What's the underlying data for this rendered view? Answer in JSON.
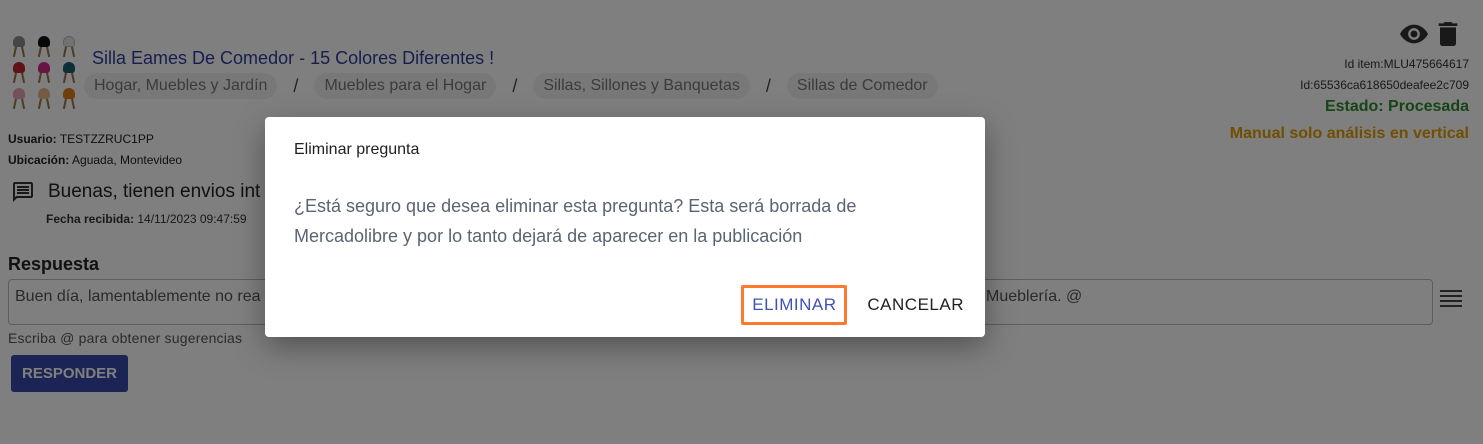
{
  "item": {
    "title": "Silla Eames De Comedor - 15 Colores Diferentes !",
    "breadcrumbs": [
      "Hogar, Muebles y Jardín",
      "Muebles para el Hogar",
      "Sillas, Sillones y Banquetas",
      "Sillas de Comedor"
    ],
    "breadcrumb_separator": "/",
    "thumbnail_icon": "chair-grid-thumbnail",
    "chair_colors": [
      "#8a8a8a",
      "#111111",
      "#e6e6e6",
      "#c0272d",
      "#d12a8c",
      "#1b5e6a",
      "#e8a0b4",
      "#e8b68f",
      "#e07a1a"
    ]
  },
  "user": {
    "usuario_label": "Usuario:",
    "usuario_value": "TESTZZRUC1PP",
    "ubicacion_label": "Ubicación:",
    "ubicacion_value": "Aguada, Montevideo"
  },
  "question": {
    "icon": "chat-bubble-icon",
    "text": "Buenas, tienen envios int",
    "date_label": "Fecha recibida:",
    "date_value": "14/11/2023 09:47:59"
  },
  "response": {
    "label": "Respuesta",
    "text_left": "Buen día, lamentablemente no rea",
    "text_right": "Mueblería. @",
    "hint": "Escriba @ para obtener sugerencias",
    "button": "RESPONDER",
    "menu_icon": "lines-menu-icon"
  },
  "side": {
    "icons": [
      "eye-icon",
      "trash-icon"
    ],
    "id_item": "Id item:MLU475664617",
    "id_hash": "Id:65536ca618650deafee2c709",
    "estado": "Estado: Procesada",
    "manual": "Manual solo análisis en vertical"
  },
  "dialog": {
    "title": "Eliminar pregunta",
    "body_line1": "¿Está seguro que desea eliminar esta pregunta? Esta será borrada de",
    "body_line2": "Mercadolibre y por lo tanto dejará de aparecer en la publicación",
    "confirm": "ELIMINAR",
    "cancel": "CANCELAR"
  },
  "colors": {
    "primary": "#3949ab",
    "title_link": "#2f3c9c",
    "estado": "#2e8b2e",
    "manual": "#e0a000",
    "highlight_border": "#ff7a2f"
  }
}
